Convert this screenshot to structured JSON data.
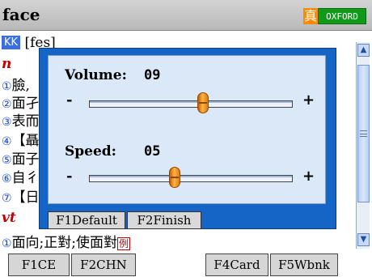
{
  "titlebar": {
    "word": "face",
    "zhen_badge": "真",
    "dict_badge": "OXFORD"
  },
  "entry": {
    "kk_tag": "KK",
    "phonetic": "[fes]",
    "pos_n": "n",
    "senses": [
      {
        "num": "①",
        "text": "臉,"
      },
      {
        "num": "②",
        "text": "面孑"
      },
      {
        "num": "③",
        "text": "表而"
      },
      {
        "num": "④",
        "text": "【聶"
      },
      {
        "num": "⑤",
        "text": "面子"
      },
      {
        "num": "⑥",
        "text": "自彳"
      },
      {
        "num": "⑦",
        "text": "【日"
      }
    ],
    "pos_vt": "vt",
    "vt_sense": {
      "num": "①",
      "text": "面向;正對;使面對",
      "example": "例"
    }
  },
  "dialog": {
    "volume_label": "Volume:",
    "volume_value": "09",
    "speed_label": "Speed:",
    "speed_value": "05",
    "minus": "-",
    "plus": "+",
    "volume_level": 0.56,
    "speed_level": 0.42,
    "btn_default": "F1Default",
    "btn_finish": "F2Finish"
  },
  "fbar": {
    "f1": "F1CE",
    "f2": "F2CHN",
    "f4": "F4Card",
    "f5": "F5Wbnk"
  },
  "scrollbar": {
    "up": "▲",
    "down": "▼"
  }
}
